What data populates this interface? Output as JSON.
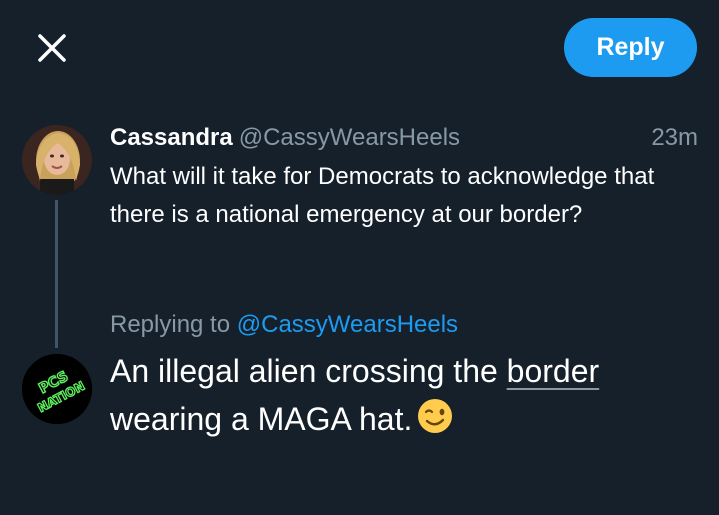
{
  "header": {
    "reply_label": "Reply"
  },
  "original_tweet": {
    "author_name": "Cassandra",
    "author_handle": "@CassyWearsHeels",
    "timestamp": "23m",
    "text": "What will it take for Democrats to acknowledge that there is a national emergency at our border?"
  },
  "reply": {
    "replying_prefix": "Replying to",
    "replying_to": "@CassyWearsHeels",
    "text_before": "An illegal alien crossing the ",
    "text_link": "border",
    "text_after": " wearing a MAGA hat.",
    "emoji": "winking-face-emoji"
  },
  "avatars": {
    "reply_logo_text": "PCS NATION"
  },
  "colors": {
    "background": "#15202b",
    "accent": "#1d9bf0",
    "muted": "#8899a6",
    "thread_line": "#425566",
    "logo_green": "#5ef05e"
  }
}
